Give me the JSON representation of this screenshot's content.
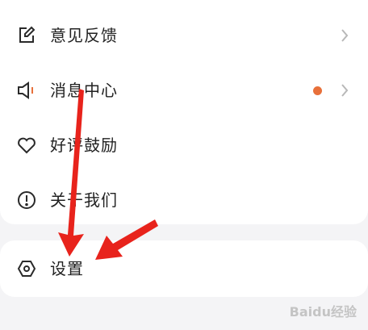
{
  "menu": {
    "items": [
      {
        "label": "意见反馈",
        "icon": "edit-icon",
        "has_chevron": true
      },
      {
        "label": "消息中心",
        "icon": "speaker-icon",
        "has_chevron": true,
        "badge_color": "#e8703a"
      },
      {
        "label": "好评鼓励",
        "icon": "heart-icon",
        "has_chevron": false
      },
      {
        "label": "关于我们",
        "icon": "info-circle-icon",
        "has_chevron": false
      }
    ],
    "settings": {
      "label": "设置",
      "icon": "settings-hexagon-icon"
    }
  },
  "colors": {
    "accent_dot": "#e8703a",
    "annotation_arrow": "#e8231c",
    "icon_stroke": "#2a2a2a",
    "chevron": "#b8b8b8"
  },
  "watermark": {
    "text": "Baidu经验"
  }
}
